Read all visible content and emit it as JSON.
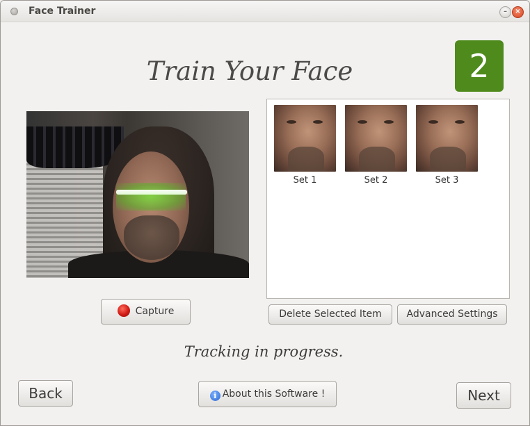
{
  "window": {
    "title": "Face Trainer",
    "minimize_glyph": "–",
    "close_glyph": "×"
  },
  "heading": "Train Your Face",
  "step_number": "2",
  "camera": {
    "icon": "webcam-feed"
  },
  "capture_button": {
    "label": "Capture",
    "icon": "record-icon"
  },
  "sets": [
    {
      "label": "Set 1"
    },
    {
      "label": "Set 2"
    },
    {
      "label": "Set 3"
    }
  ],
  "actions": {
    "delete_label": "Delete Selected Item",
    "advanced_label": "Advanced Settings"
  },
  "status": "Tracking in progress.",
  "nav": {
    "back_label": "Back",
    "about_label": "About this Software !",
    "about_icon_glyph": "i",
    "next_label": "Next"
  },
  "colors": {
    "step_badge": "#4e8a1c",
    "window_bg": "#f2f1f0",
    "close_button": "#d9441f"
  }
}
